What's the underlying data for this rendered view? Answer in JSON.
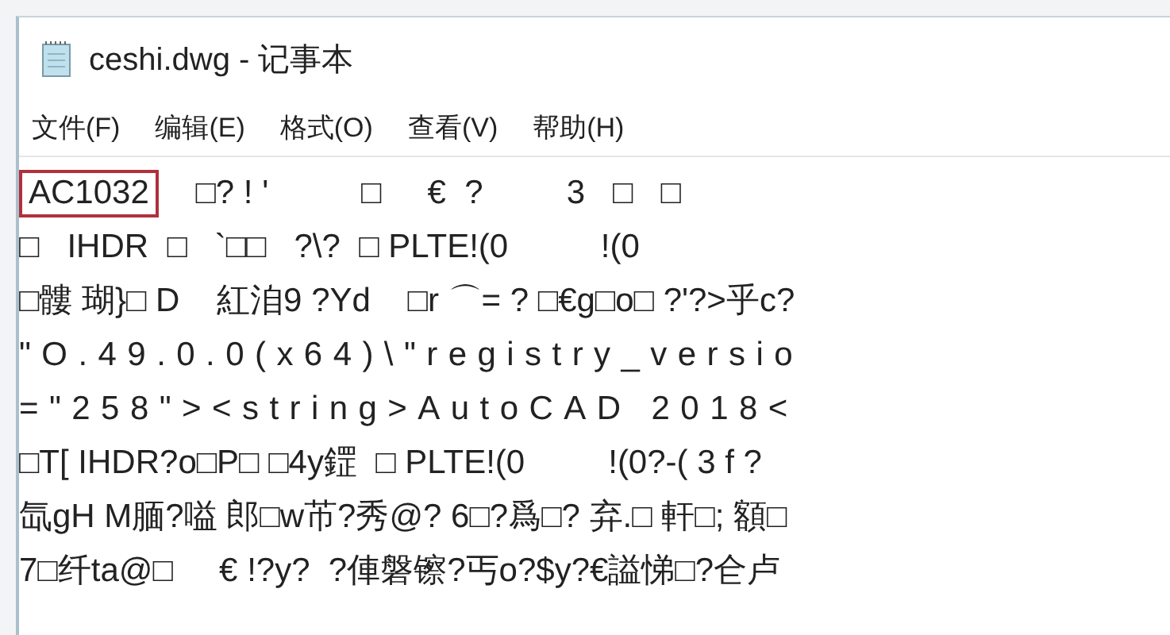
{
  "window": {
    "title": "ceshi.dwg - 记事本"
  },
  "menu": [
    "文件(F)",
    "编辑(E)",
    "格式(O)",
    "查看(V)",
    "帮助(H)"
  ],
  "lines": [
    {
      "spaced": false,
      "segments": [
        {
          "text": "AC1032",
          "boxed": true
        },
        {
          "text": "    □? ! '          □     €  ?         3   □   □",
          "boxed": false
        }
      ]
    },
    {
      "spaced": false,
      "segments": [
        {
          "text": "□   IHDR  □   `□□   ?\\?  □ PLTE!(0          !(0",
          "boxed": false
        }
      ]
    },
    {
      "spaced": false,
      "segments": [
        {
          "text": "□髏 瑚}□ D    紅洎9 ?Yd    □r ⌒= ? □€g□o□ ?'?>乎c?",
          "boxed": false
        }
      ]
    },
    {
      "spaced": true,
      "segments": [
        {
          "text": "\"O.49.0.0(x64)\\\"registry_versio",
          "boxed": false
        }
      ]
    },
    {
      "spaced": true,
      "segments": [
        {
          "text": "=\"258\"><string>AutoCAD 2018<",
          "boxed": false
        }
      ]
    },
    {
      "spaced": false,
      "segments": [
        {
          "text": "□T[ IHDR?o□P□ □4y鎠  □ PLTE!(0         !(0?-( 3 f ?",
          "boxed": false
        }
      ]
    },
    {
      "spaced": false,
      "segments": [
        {
          "text": "氙gH M腼?嗌 郎□w芇?秀@? 6□?爲□? 弃.□ 軒□; 額□",
          "boxed": false
        }
      ]
    },
    {
      "spaced": false,
      "segments": [
        {
          "text": "7□纤ta@□     € !?y?  ?俥磐镲?丐o?$y?€謚悌□?仺卢",
          "boxed": false
        }
      ]
    }
  ]
}
